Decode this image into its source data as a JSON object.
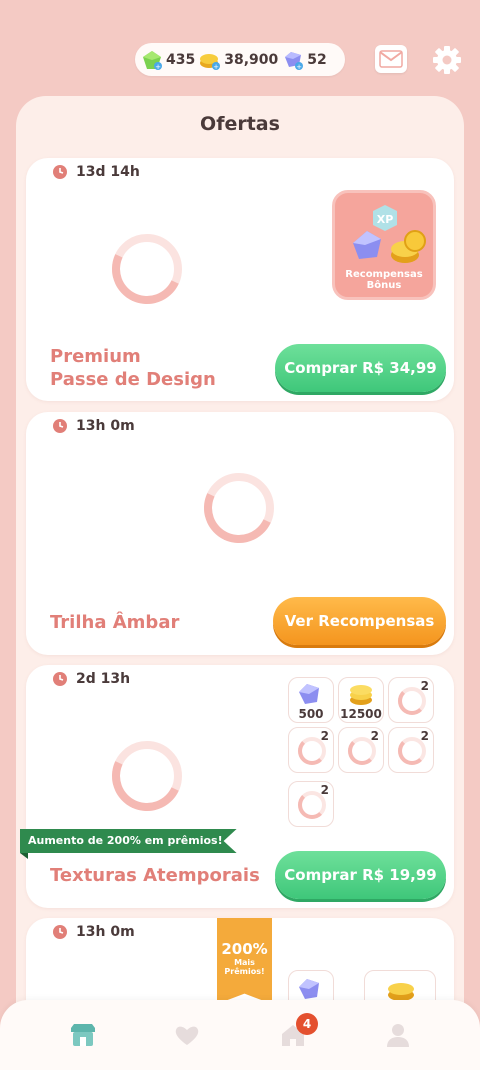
{
  "currency": {
    "green_gems": "435",
    "coins": "38,900",
    "diamonds": "52"
  },
  "icons": {
    "mail": "mail-icon",
    "settings": "gear-icon",
    "clock": "clock-icon",
    "nav": [
      "shop-icon",
      "heart-icon",
      "home-icon",
      "profile-icon"
    ]
  },
  "panel": {
    "title": "Ofertas"
  },
  "offers": [
    {
      "timer": "13d 14h",
      "title_line1": "Premium",
      "title_line2": "Passe de Design",
      "button": "Comprar  R$ 34,99",
      "bonus_badge": "XP",
      "bonus_label_1": "Recompensas",
      "bonus_label_2": "Bônus"
    },
    {
      "timer": "13h 0m",
      "title": "Trilha Âmbar",
      "button": "Ver Recompensas"
    },
    {
      "timer": "2d 13h",
      "title": "Texturas Atemporais",
      "button": "Comprar  R$ 19,99",
      "ribbon": "Aumento de 200% em prêmios!",
      "rewards": [
        {
          "kind": "diamond",
          "amount": "500"
        },
        {
          "kind": "coins",
          "amount": "12500"
        },
        {
          "kind": "loading",
          "count": "2"
        },
        {
          "kind": "loading",
          "count": "2"
        },
        {
          "kind": "loading",
          "count": "2"
        },
        {
          "kind": "loading",
          "count": "2"
        },
        {
          "kind": "loading",
          "count": "2"
        }
      ]
    },
    {
      "timer": "13h 0m",
      "tag_big": "200%",
      "tag_small_1": "Mais",
      "tag_small_2": "Prêmios!"
    }
  ],
  "nav": {
    "badge_count": "4"
  },
  "colors": {
    "background": "#f4cac4",
    "title_pink": "#e17f78",
    "green_button": "#3fc77a",
    "orange_button": "#f4951e",
    "ribbon_green": "#2f8a4e",
    "badge_red": "#e4502f"
  }
}
